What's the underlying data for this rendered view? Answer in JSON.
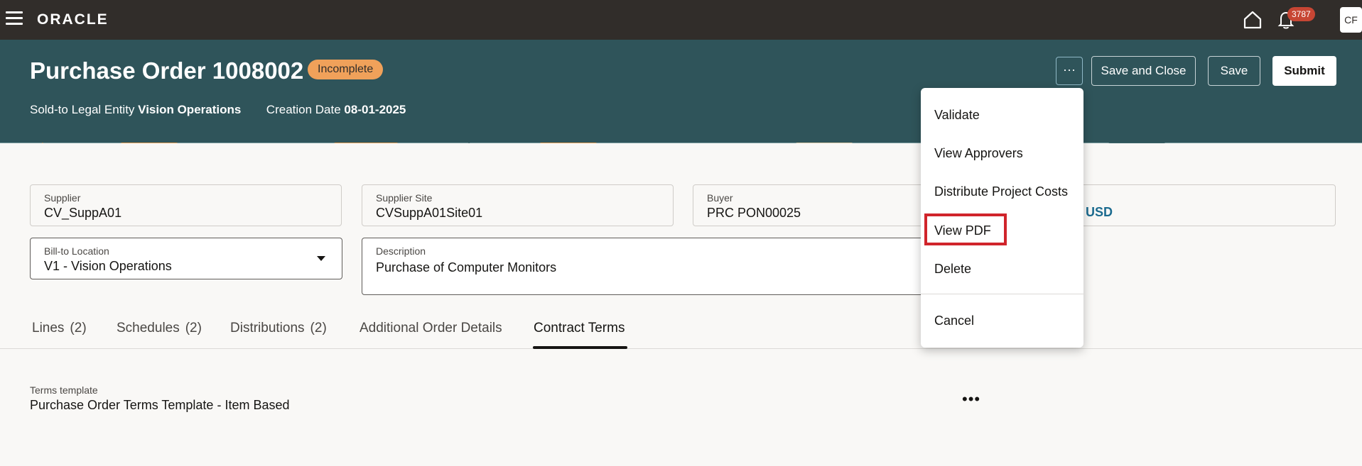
{
  "topbar": {
    "logo": "ORACLE",
    "notifications_count": "3787",
    "avatar_initials": "CF"
  },
  "header": {
    "title": "Purchase Order 1008002",
    "status": "Incomplete",
    "sold_to_label": "Sold-to Legal Entity",
    "sold_to_value": "Vision Operations",
    "creation_date_label": "Creation Date",
    "creation_date_value": "08-01-2025",
    "more_label": "···",
    "save_close_label": "Save and Close",
    "save_label": "Save",
    "submit_label": "Submit"
  },
  "form": {
    "supplier": {
      "label": "Supplier",
      "value": "CV_SuppA01"
    },
    "supplier_site": {
      "label": "Supplier Site",
      "value": "CVSuppA01Site01"
    },
    "buyer": {
      "label": "Buyer",
      "value": "PRC PON00025"
    },
    "amount": {
      "value": "0 USD"
    },
    "bill_to": {
      "label": "Bill-to Location",
      "value": "V1 - Vision Operations"
    },
    "description": {
      "label": "Description",
      "value": "Purchase of Computer Monitors"
    }
  },
  "tabs": [
    {
      "label": "Lines",
      "count": "(2)"
    },
    {
      "label": "Schedules",
      "count": "(2)"
    },
    {
      "label": "Distributions",
      "count": "(2)"
    },
    {
      "label": "Additional Order Details",
      "count": ""
    },
    {
      "label": "Contract Terms",
      "count": "",
      "active": true
    }
  ],
  "terms": {
    "label": "Terms template",
    "value": "Purchase Order Terms Template - Item Based",
    "more_label": "•••"
  },
  "menu": {
    "items": [
      {
        "label": "Validate"
      },
      {
        "label": "View Approvers"
      },
      {
        "label": "Distribute Project Costs"
      },
      {
        "label": "View PDF",
        "highlighted": true
      },
      {
        "label": "Delete"
      },
      {
        "label": "Cancel"
      }
    ]
  },
  "colors": {
    "topbar": "#312d2a",
    "header": "#2f545a",
    "status_badge": "#f0a15a",
    "notification_badge": "#c74634",
    "highlight_box": "#d0242b",
    "link_value": "#1c6b8f"
  }
}
